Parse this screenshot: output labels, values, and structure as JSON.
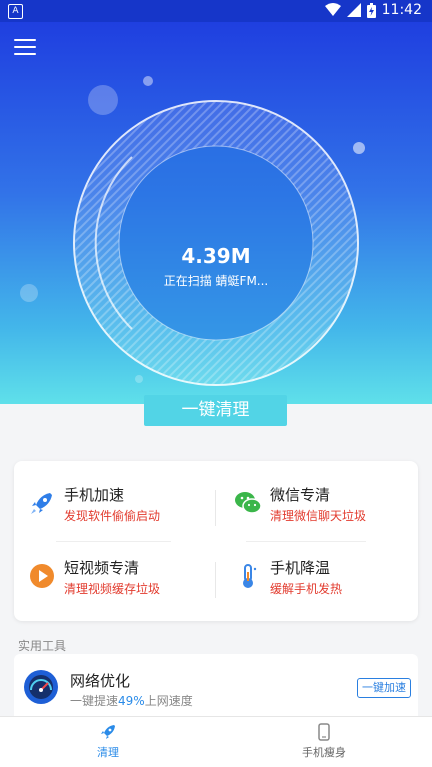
{
  "status_bar": {
    "notification_letter": "A",
    "time": "11:42"
  },
  "hero": {
    "size": "4.39M",
    "scan_status": "正在扫描 蜻蜓FM..."
  },
  "clean_button": "一键清理",
  "features": [
    {
      "title": "手机加速",
      "subtitle": "发现软件偷偷启动",
      "icon": "rocket-icon",
      "color": "#2f7ee8"
    },
    {
      "title": "微信专清",
      "subtitle": "清理微信聊天垃圾",
      "icon": "wechat-icon",
      "color": "#3bb64a"
    },
    {
      "title": "短视频专清",
      "subtitle": "清理视频缓存垃圾",
      "icon": "play-icon",
      "color": "#f08a2c"
    },
    {
      "title": "手机降温",
      "subtitle": "缓解手机发热",
      "icon": "thermometer-icon",
      "color": "#3a86e6"
    }
  ],
  "tools_section": {
    "title": "实用工具",
    "items": [
      {
        "name": "网络优化",
        "desc_prefix": "一键提速",
        "desc_percent": "49%",
        "desc_suffix": "上网速度",
        "button": "一键加速",
        "icon": "speedometer-icon"
      }
    ]
  },
  "bottom_nav": [
    {
      "label": "清理",
      "icon": "rocket-icon",
      "active": true
    },
    {
      "label": "手机瘦身",
      "icon": "phone-icon",
      "active": false
    }
  ],
  "colors": {
    "accent": "#2a8be8",
    "alert": "#e23b2e",
    "clean_button": "#52d4e6"
  }
}
